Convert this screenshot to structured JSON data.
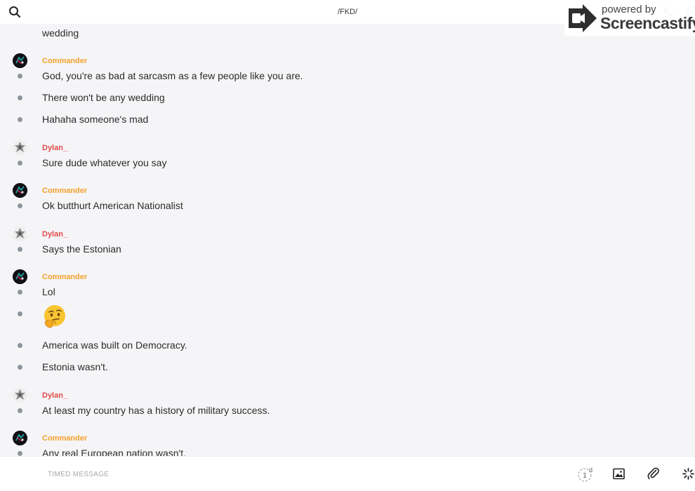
{
  "header": {
    "title": "/FKD/",
    "icons": [
      "search-icon",
      "phone-icon",
      "info-icon"
    ]
  },
  "watermark": {
    "powered_by": "powered by",
    "brand": "Screencastify"
  },
  "messages": {
    "m0": "wedding",
    "g1": {
      "sender": "Commander"
    },
    "m1": "God, you're as bad at sarcasm as a few people like you are.",
    "m2": "There won't be any wedding",
    "m3": "Hahaha someone's mad",
    "g2": {
      "sender": "Dylan_"
    },
    "m4": "Sure dude whatever you say",
    "g3": {
      "sender": "Commander"
    },
    "m5": "Ok butthurt American Nationalist",
    "g4": {
      "sender": "Dylan_"
    },
    "m6": "Says the Estonian",
    "g5": {
      "sender": "Commander"
    },
    "m7": "Lol",
    "m8": "thinking-face-emoji",
    "m9": "America was built on Democracy.",
    "m10": "Estonia wasn't.",
    "g6": {
      "sender": "Dylan_"
    },
    "m11": "At least my country has a history of military success.",
    "g7": {
      "sender": "Commander"
    },
    "m12": "Any real European nation wasn't."
  },
  "composer": {
    "timed_label": "TIMED MESSAGE",
    "timer_value": "1",
    "timer_unit": "d",
    "icons": [
      "timer-icon",
      "image-icon",
      "paperclip-icon",
      "spinner-icon"
    ]
  },
  "colors": {
    "commander": "#f5a02c",
    "dylan": "#e24b4b",
    "bullet": "#8e959c",
    "background": "#f5f5f7"
  }
}
